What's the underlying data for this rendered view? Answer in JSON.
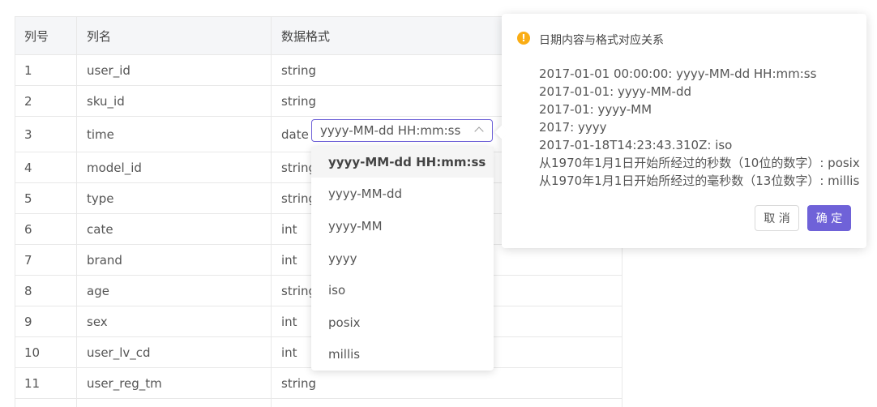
{
  "table": {
    "headers": [
      "列号",
      "列名",
      "数据格式"
    ],
    "rows": [
      {
        "no": "1",
        "name": "user_id",
        "fmt": "string"
      },
      {
        "no": "2",
        "name": "sku_id",
        "fmt": "string"
      },
      {
        "no": "3",
        "name": "time",
        "fmt": "date"
      },
      {
        "no": "4",
        "name": "model_id",
        "fmt": "string"
      },
      {
        "no": "5",
        "name": "type",
        "fmt": "string"
      },
      {
        "no": "6",
        "name": "cate",
        "fmt": "int"
      },
      {
        "no": "7",
        "name": "brand",
        "fmt": "int"
      },
      {
        "no": "8",
        "name": "age",
        "fmt": "string"
      },
      {
        "no": "9",
        "name": "sex",
        "fmt": "int"
      },
      {
        "no": "10",
        "name": "user_lv_cd",
        "fmt": "int"
      },
      {
        "no": "11",
        "name": "user_reg_tm",
        "fmt": "string"
      }
    ]
  },
  "date_select": {
    "value": "yyyy-MM-dd HH:mm:ss",
    "options": [
      "yyyy-MM-dd HH:mm:ss",
      "yyyy-MM-dd",
      "yyyy-MM",
      "yyyy",
      "iso",
      "posix",
      "millis"
    ]
  },
  "popover": {
    "icon": "warning-icon",
    "title": "日期内容与格式对应关系",
    "lines": [
      "2017-01-01 00:00:00: yyyy-MM-dd HH:mm:ss",
      "2017-01-01: yyyy-MM-dd",
      "2017-01: yyyy-MM",
      "2017: yyyy",
      "2017-01-18T14:23:43.310Z: iso",
      "从1970年1月1日开始所经过的秒数（10位的数字）: posix",
      "从1970年1月1日开始所经过的毫秒数（13位数字）: millis"
    ],
    "cancel_label": "取 消",
    "ok_label": "确 定"
  },
  "colors": {
    "accent": "#6f62d8",
    "warning": "#faad14"
  }
}
